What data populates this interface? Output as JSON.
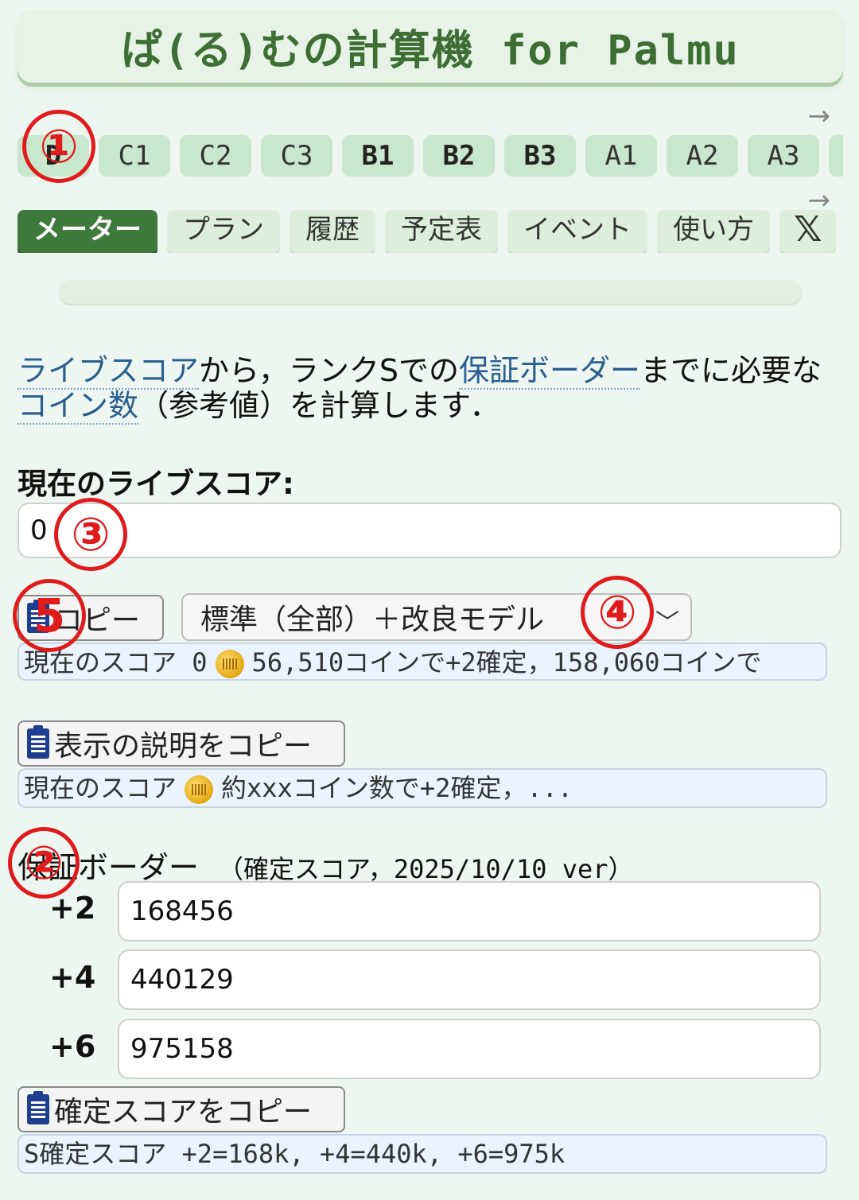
{
  "header": {
    "title": "ぱ(る)むの計算機 for Palmu"
  },
  "rank_tabs": {
    "scroll_arrow": "→",
    "items": [
      "D",
      "C1",
      "C2",
      "C3",
      "B1",
      "B2",
      "B3",
      "A1",
      "A2",
      "A3"
    ],
    "bold": [
      "D",
      "B1",
      "B2",
      "B3"
    ]
  },
  "nav_tabs": {
    "scroll_arrow": "→",
    "items": [
      "メーター",
      "プラン",
      "履歴",
      "予定表",
      "イベント",
      "使い方",
      "𝕏"
    ],
    "active": "メーター"
  },
  "intro": {
    "link_live_score": "ライブスコア",
    "t1": "から，ランクSでの",
    "link_border": "保証ボーダー",
    "t2": "までに必要な",
    "link_coins": "コイン数",
    "t3": "（参考値）を計算します．"
  },
  "score_section": {
    "label": "現在のライブスコア:",
    "value": "0"
  },
  "copy_button": {
    "label": "コピー"
  },
  "model_select": {
    "selected": "標準（全部）＋改良モデル"
  },
  "result_output": {
    "prefix": "現在のスコア 0",
    "suffix": "56,510コインで+2確定，158,060コインで"
  },
  "explain_copy_button": {
    "label": "表示の説明をコピー"
  },
  "explain_output": {
    "prefix": "現在のスコア",
    "suffix": "約xxxコイン数で+2確定，..."
  },
  "border_section": {
    "title": "保証ボーダー",
    "subtitle": "（確定スコア，2025/10/10 ver）",
    "rows": [
      {
        "label": "+2",
        "value": "168456"
      },
      {
        "label": "+4",
        "value": "440129"
      },
      {
        "label": "+6",
        "value": "975158"
      }
    ]
  },
  "confirm_copy_button": {
    "label": "確定スコアをコピー"
  },
  "confirm_output": {
    "text": "S確定スコア +2=168k, +4=440k, +6=975k"
  },
  "annotations": [
    "①",
    "②",
    "③",
    "④",
    "5"
  ],
  "colors": {
    "accent": "#3f7a3d",
    "marker": "#e01b1b",
    "link": "#2a5f8f"
  }
}
